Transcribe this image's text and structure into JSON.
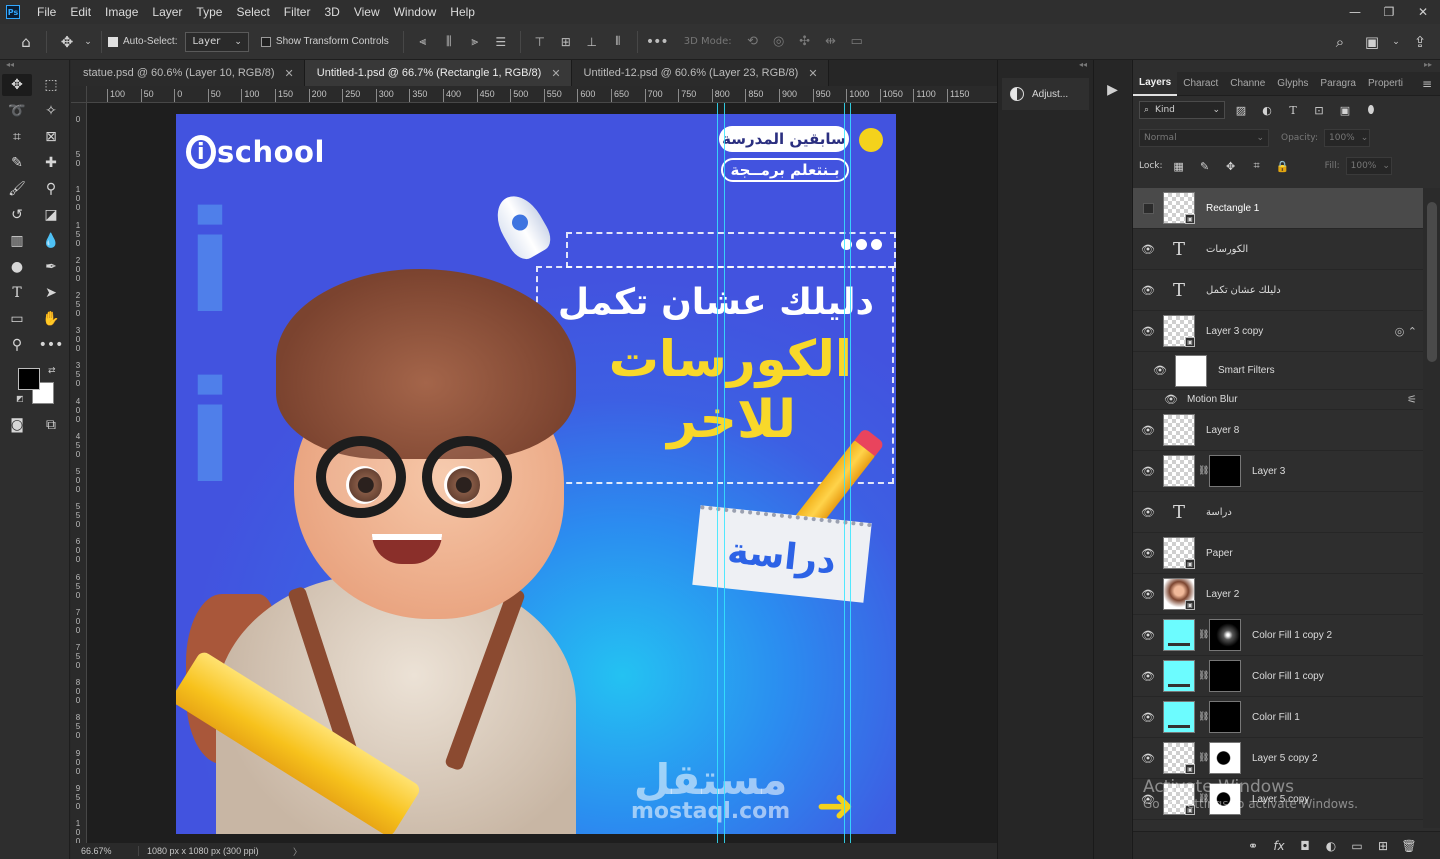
{
  "app": {
    "logo": "Ps"
  },
  "menu": [
    "File",
    "Edit",
    "Image",
    "Layer",
    "Type",
    "Select",
    "Filter",
    "3D",
    "View",
    "Window",
    "Help"
  ],
  "window_controls": {
    "minimize": "—",
    "restore": "❐",
    "close": "✕"
  },
  "options_bar": {
    "auto_select_label": "Auto-Select:",
    "auto_select_checked": true,
    "auto_select_target": "Layer",
    "show_transform_label": "Show Transform Controls",
    "show_transform_checked": false,
    "more_label": "•••",
    "mode_label": "3D Mode:"
  },
  "tabs": [
    {
      "title": "statue.psd @ 60.6% (Layer 10, RGB/8)",
      "active": false
    },
    {
      "title": "Untitled-1.psd @ 66.7% (Rectangle 1, RGB/8)",
      "active": true
    },
    {
      "title": "Untitled-12.psd @ 60.6% (Layer 23, RGB/8)",
      "active": false
    }
  ],
  "ruler_top": [
    "100",
    "50",
    "0",
    "50",
    "100",
    "150",
    "200",
    "250",
    "300",
    "350",
    "400",
    "450",
    "500",
    "550",
    "600",
    "650",
    "700",
    "750",
    "800",
    "850",
    "900",
    "950",
    "1000",
    "1050",
    "1100",
    "1150"
  ],
  "ruler_left": [
    "0",
    "50",
    "100",
    "150",
    "200",
    "250",
    "300",
    "350",
    "400",
    "450",
    "500",
    "550",
    "600",
    "650",
    "700",
    "750",
    "800",
    "850",
    "900",
    "950",
    "1000"
  ],
  "design": {
    "logo_text": "school",
    "logo_i": "i",
    "pill_top": "سابقين المدرسة",
    "pill_bottom": "بـنتعلم برمــجة",
    "headline_1": "دليلك عشان تكمل",
    "headline_2": "الكورسات",
    "headline_3": "للاخر",
    "paper_text": "دراسة",
    "watermark_ar": "مستقل",
    "watermark_en": "mostaql.com",
    "arrow": "➜",
    "colors": {
      "background": "#4253df",
      "accent_yellow": "#f4d21c",
      "guide": "#35e6ff"
    }
  },
  "status": {
    "zoom": "66.67%",
    "doc_info": "1080 px x 1080 px (300 ppi)",
    "more": "〉"
  },
  "collapsed_panel": {
    "label": "Adjust..."
  },
  "layers_panel": {
    "tabs": [
      {
        "label": "Layers",
        "active": true
      },
      {
        "label": "Charact",
        "active": false
      },
      {
        "label": "Channe",
        "active": false
      },
      {
        "label": "Glyphs",
        "active": false
      },
      {
        "label": "Paragra",
        "active": false
      },
      {
        "label": "Properti",
        "active": false
      }
    ],
    "filter_kind": "Kind",
    "blend_mode": "Normal",
    "opacity_label": "Opacity:",
    "opacity_value": "100%",
    "lock_label": "Lock:",
    "fill_label": "Fill:",
    "fill_value": "100%",
    "layers": [
      {
        "name": "Rectangle 1",
        "kind": "smart",
        "visible": false,
        "selected": true
      },
      {
        "name": "الكورسات",
        "kind": "text",
        "visible": true
      },
      {
        "name": "دليلك عشان تكمل",
        "kind": "text",
        "visible": true
      },
      {
        "name": "Layer 3 copy",
        "kind": "smart",
        "visible": true,
        "has_filters": true
      },
      {
        "name": "Smart Filters",
        "kind": "smartfilters",
        "visible": true
      },
      {
        "name": "Motion Blur",
        "kind": "filter",
        "visible": true
      },
      {
        "name": "Layer 8",
        "kind": "pixel",
        "visible": true
      },
      {
        "name": "Layer 3",
        "kind": "masked",
        "mask": "black",
        "visible": true
      },
      {
        "name": "دراسة",
        "kind": "text",
        "visible": true
      },
      {
        "name": "Paper",
        "kind": "smart",
        "visible": true
      },
      {
        "name": "Layer 2",
        "kind": "boy",
        "visible": true
      },
      {
        "name": "Color Fill 1 copy 2",
        "kind": "fill",
        "mask": "glow",
        "visible": true
      },
      {
        "name": "Color Fill 1 copy",
        "kind": "fill",
        "mask": "black",
        "visible": true
      },
      {
        "name": "Color Fill 1",
        "kind": "fill",
        "mask": "black",
        "visible": true
      },
      {
        "name": "Layer 5 copy 2",
        "kind": "masked-smart",
        "mask": "spot",
        "visible": true
      },
      {
        "name": "Layer 5 copy",
        "kind": "masked-smart",
        "mask": "spot",
        "visible": true
      }
    ]
  },
  "activation": {
    "title": "Activate Windows",
    "subtitle": "Go to Settings to activate Windows."
  }
}
